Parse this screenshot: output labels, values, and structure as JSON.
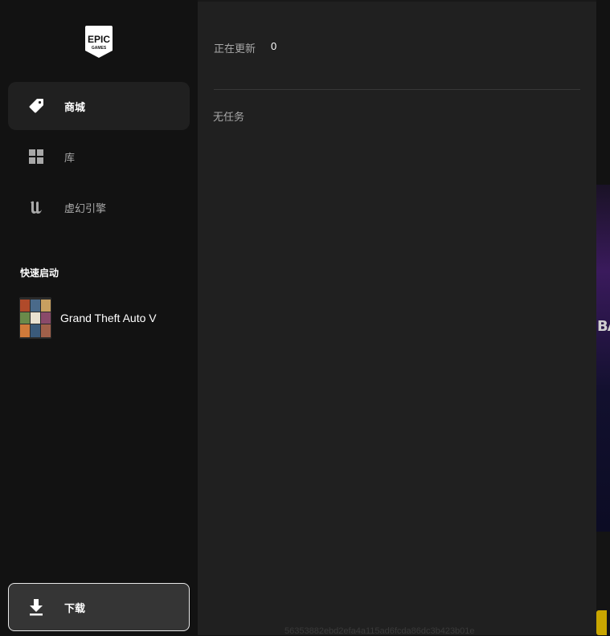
{
  "sidebar": {
    "logo_text_top": "EPIC",
    "logo_text_bottom": "GAMES",
    "nav": [
      {
        "label": "商城",
        "icon": "tag-icon",
        "active": true
      },
      {
        "label": "库",
        "icon": "grid-icon",
        "active": false
      },
      {
        "label": "虚幻引擎",
        "icon": "unreal-engine-icon",
        "active": false
      }
    ],
    "quick_launch": {
      "title": "快速启动",
      "items": [
        {
          "name": "Grand Theft Auto V"
        }
      ]
    },
    "download": {
      "label": "下载",
      "icon": "download-arrow-icon"
    }
  },
  "downloads_panel": {
    "updating_label": "正在更新",
    "updating_count": "0",
    "empty_text": "无任务",
    "build_hash": "56353882ebd2efa4a115ad6fcda86dc3b423b01e"
  },
  "backdrop": {
    "hero_text": "BA"
  },
  "colors": {
    "background": "#121212",
    "panel": "#202020",
    "active_item": "#202020",
    "accent_yellow": "#c9a600"
  }
}
